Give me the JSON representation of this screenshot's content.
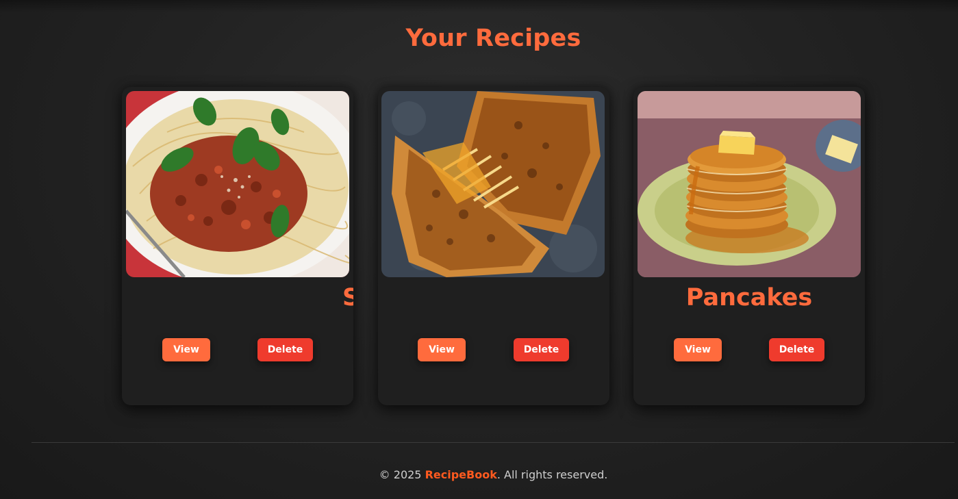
{
  "header": {
    "title": "Your Recipes"
  },
  "recipes": [
    {
      "title": "Spaghetti",
      "view_label": "View",
      "delete_label": "Delete"
    },
    {
      "title": "",
      "view_label": "View",
      "delete_label": "Delete"
    },
    {
      "title": "Pancakes",
      "view_label": "View",
      "delete_label": "Delete"
    }
  ],
  "footer": {
    "copyright": "© 2025 ",
    "brand": "RecipeBook",
    "rights": ". All rights reserved."
  },
  "colors": {
    "accent": "#ff6b3d",
    "delete": "#ef3b2d",
    "card_bg": "#1f1f1f",
    "page_bg": "#232323"
  }
}
